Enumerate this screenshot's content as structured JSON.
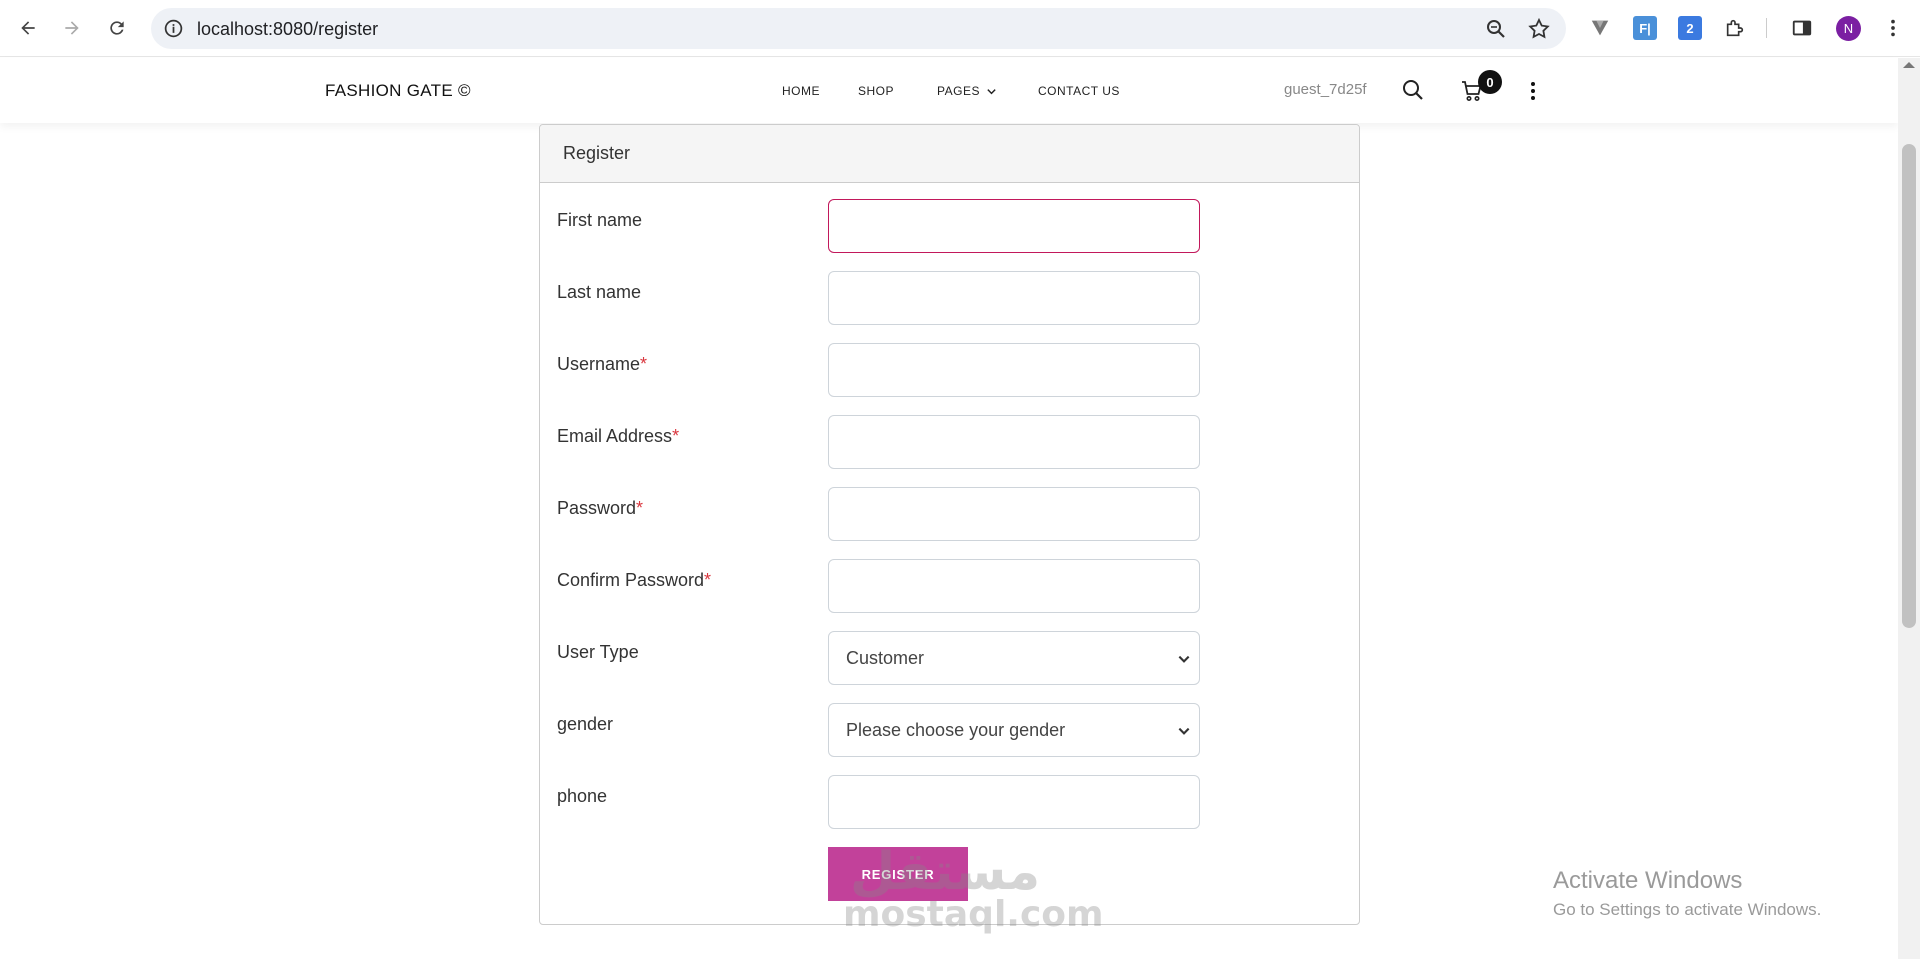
{
  "browser": {
    "url": "localhost:8080/register",
    "profile_initial": "N",
    "ext_f_label": "F|",
    "ext_2_label": "2"
  },
  "header": {
    "brand": "FASHION GATE ©",
    "menu": [
      "HOME",
      "SHOP",
      "PAGES",
      "CONTACT US"
    ],
    "username": "guest_7d25f",
    "cart_count": "0"
  },
  "form": {
    "title": "Register",
    "fields": [
      {
        "label": "First name",
        "required": false,
        "type": "text",
        "value": ""
      },
      {
        "label": "Last name",
        "required": false,
        "type": "text",
        "value": ""
      },
      {
        "label": "Username",
        "required": true,
        "type": "text",
        "value": ""
      },
      {
        "label": "Email Address",
        "required": true,
        "type": "text",
        "value": ""
      },
      {
        "label": "Password",
        "required": true,
        "type": "password",
        "value": ""
      },
      {
        "label": "Confirm Password",
        "required": true,
        "type": "password",
        "value": ""
      },
      {
        "label": "User Type",
        "required": false,
        "type": "select",
        "value": "Customer"
      },
      {
        "label": "gender",
        "required": false,
        "type": "select",
        "value": "Please choose your gender"
      },
      {
        "label": "phone",
        "required": false,
        "type": "text",
        "value": ""
      }
    ],
    "required_mark": "*",
    "submit_label": "REGISTER"
  },
  "watermark": {
    "arabic": "مستقل",
    "latin": "mostaql.com"
  },
  "os_notice": {
    "title": "Activate Windows",
    "subtitle": "Go to Settings to activate Windows."
  },
  "colors": {
    "accent": "#c2419a",
    "focus_border": "#c2185b",
    "required": "#d9363e"
  }
}
